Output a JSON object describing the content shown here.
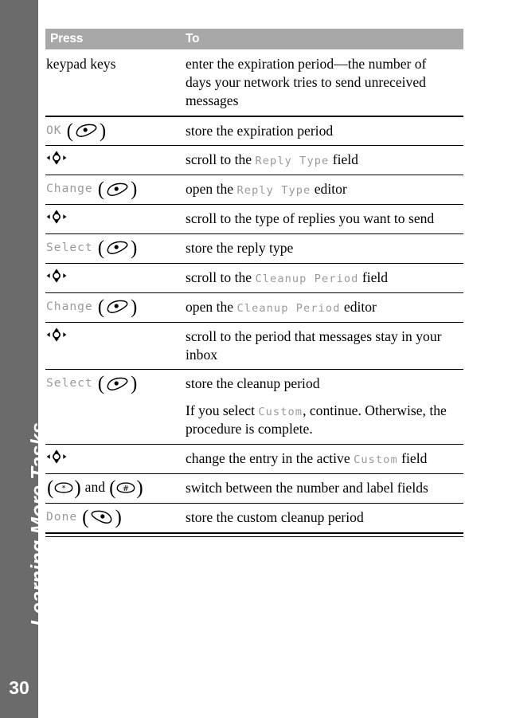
{
  "sidebar": {
    "chapter_title": "Learning More Tasks",
    "page_number": "30",
    "background_color": "#6b6b6b",
    "text_color": "#ffffff"
  },
  "table": {
    "header_background_color": "#a8a8a8",
    "header_text_color": "#ffffff",
    "screen_text_color": "#9a9a9a",
    "columns": [
      {
        "label": "Press"
      },
      {
        "label": "To"
      }
    ],
    "rows": [
      {
        "press": {
          "type": "text",
          "label": "keypad keys"
        },
        "to": [
          {
            "parts": [
              {
                "text": "enter the expiration period—the number of days your network tries to send unreceived messages",
                "style": "body"
              }
            ]
          }
        ]
      },
      {
        "press": {
          "type": "softkey-left",
          "label": "OK",
          "icon": "softkey-left-icon"
        },
        "to": [
          {
            "parts": [
              {
                "text": "store the expiration period",
                "style": "body"
              }
            ]
          }
        ]
      },
      {
        "press": {
          "type": "navkey",
          "label": "",
          "icon": "navigation-key-icon"
        },
        "to": [
          {
            "parts": [
              {
                "text": "scroll to the ",
                "style": "body"
              },
              {
                "text": "Reply Type",
                "style": "screen"
              },
              {
                "text": " field",
                "style": "body"
              }
            ]
          }
        ]
      },
      {
        "press": {
          "type": "softkey-left",
          "label": "Change",
          "icon": "softkey-left-icon"
        },
        "to": [
          {
            "parts": [
              {
                "text": "open the ",
                "style": "body"
              },
              {
                "text": "Reply Type",
                "style": "screen"
              },
              {
                "text": " editor",
                "style": "body"
              }
            ]
          }
        ]
      },
      {
        "press": {
          "type": "navkey",
          "label": "",
          "icon": "navigation-key-icon"
        },
        "to": [
          {
            "parts": [
              {
                "text": "scroll to the type of replies you want to send",
                "style": "body"
              }
            ]
          }
        ]
      },
      {
        "press": {
          "type": "softkey-left",
          "label": "Select",
          "icon": "softkey-left-icon"
        },
        "to": [
          {
            "parts": [
              {
                "text": "store the reply type",
                "style": "body"
              }
            ]
          }
        ]
      },
      {
        "press": {
          "type": "navkey",
          "label": "",
          "icon": "navigation-key-icon"
        },
        "to": [
          {
            "parts": [
              {
                "text": "scroll to the ",
                "style": "body"
              },
              {
                "text": "Cleanup Period",
                "style": "screen"
              },
              {
                "text": " field",
                "style": "body"
              }
            ]
          }
        ]
      },
      {
        "press": {
          "type": "softkey-left",
          "label": "Change",
          "icon": "softkey-left-icon"
        },
        "to": [
          {
            "parts": [
              {
                "text": "open the ",
                "style": "body"
              },
              {
                "text": "Cleanup Period",
                "style": "screen"
              },
              {
                "text": " editor",
                "style": "body"
              }
            ]
          }
        ]
      },
      {
        "press": {
          "type": "navkey",
          "label": "",
          "icon": "navigation-key-icon"
        },
        "to": [
          {
            "parts": [
              {
                "text": "scroll to the period that messages stay in your inbox",
                "style": "body"
              }
            ]
          }
        ]
      },
      {
        "press": {
          "type": "softkey-left",
          "label": "Select",
          "icon": "softkey-left-icon"
        },
        "to": [
          {
            "parts": [
              {
                "text": "store the cleanup period",
                "style": "body"
              }
            ]
          },
          {
            "parts": [
              {
                "text": "If you select ",
                "style": "body"
              },
              {
                "text": "Custom",
                "style": "screen"
              },
              {
                "text": ", continue. Otherwise, the procedure is complete.",
                "style": "body"
              }
            ]
          }
        ]
      },
      {
        "press": {
          "type": "navkey",
          "label": "",
          "icon": "navigation-key-icon"
        },
        "to": [
          {
            "parts": [
              {
                "text": "change the entry in the active ",
                "style": "body"
              },
              {
                "text": "Custom",
                "style": "screen"
              },
              {
                "text": " field",
                "style": "body"
              }
            ]
          }
        ]
      },
      {
        "press": {
          "type": "star-and-pound",
          "label": "and",
          "icon": "star-key-icon",
          "icon2": "pound-key-icon"
        },
        "to": [
          {
            "parts": [
              {
                "text": "switch between the number and label fields",
                "style": "body"
              }
            ]
          }
        ]
      },
      {
        "press": {
          "type": "softkey-right",
          "label": "Done",
          "icon": "softkey-right-icon"
        },
        "to": [
          {
            "parts": [
              {
                "text": "store the custom cleanup period",
                "style": "body"
              }
            ]
          }
        ]
      }
    ]
  }
}
